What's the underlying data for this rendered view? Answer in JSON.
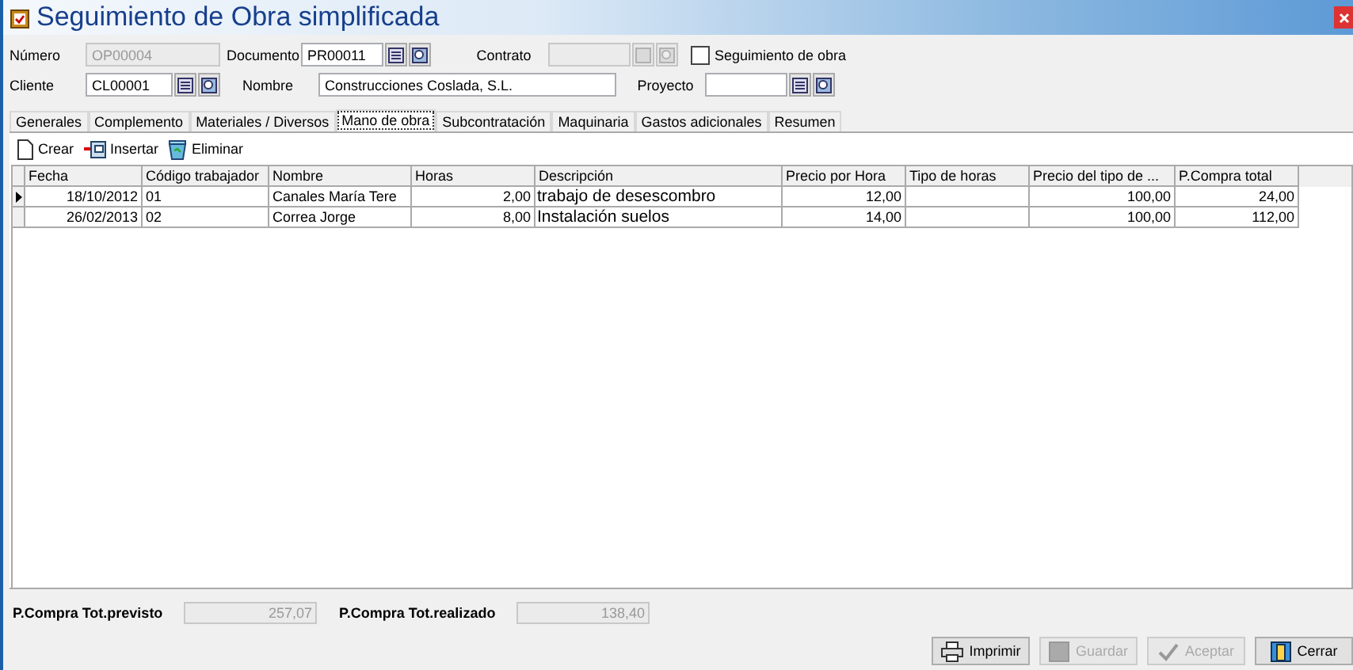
{
  "window": {
    "title": "Seguimiento de Obra simplificada"
  },
  "header": {
    "numero": {
      "label": "Número",
      "value": "OP00004",
      "disabled": true
    },
    "documento": {
      "label": "Documento",
      "value": "PR00011",
      "disabled": false
    },
    "contrato": {
      "label": "Contrato",
      "disabled": true
    },
    "seguimiento": {
      "label": "Seguimiento de obra",
      "checked": false
    },
    "cliente": {
      "label": "Cliente",
      "value": "CL00001",
      "disabled": false
    },
    "nombre": {
      "label": "Nombre",
      "value": "Construcciones Coslada, S.L."
    },
    "proyecto": {
      "label": "Proyecto",
      "disabled": false
    }
  },
  "tabs": [
    {
      "label": "Generales",
      "selected": false
    },
    {
      "label": "Complemento",
      "selected": false
    },
    {
      "label": "Materiales / Diversos",
      "selected": false
    },
    {
      "label": "Mano de obra",
      "selected": true
    },
    {
      "label": "Subcontratación",
      "selected": false
    },
    {
      "label": "Maquinaria",
      "selected": false
    },
    {
      "label": "Gastos adicionales",
      "selected": false
    },
    {
      "label": "Resumen",
      "selected": false
    }
  ],
  "toolbar": [
    {
      "label": "Crear",
      "kind": "new"
    },
    {
      "label": "Insertar",
      "kind": "insert"
    },
    {
      "label": "Eliminar",
      "kind": "delete"
    }
  ],
  "table": {
    "columns": [
      "Fecha",
      "Código trabajador",
      "Nombre",
      "Horas",
      "Descripción",
      "Precio por Hora",
      "Tipo de horas",
      "Precio del tipo de ...",
      "P.Compra total"
    ],
    "rows": [
      {
        "selected": true,
        "cells": [
          "18/10/2012",
          "01",
          "Canales María Tere",
          "2,00",
          "trabajo de desescombro",
          "12,00",
          "",
          "100,00",
          "24,00"
        ]
      },
      {
        "selected": false,
        "cells": [
          "26/02/2013",
          "02",
          "Correa Jorge",
          "8,00",
          "Instalación suelos",
          "14,00",
          "",
          "100,00",
          "112,00"
        ]
      }
    ]
  },
  "totals": [
    {
      "label": "P.Compra Tot.previsto",
      "value": "257,07"
    },
    {
      "label": "P.Compra Tot.realizado",
      "value": "138,40"
    }
  ],
  "buttons": [
    {
      "label": "Imprimir",
      "kind": "print",
      "disabled": false
    },
    {
      "label": "Guardar",
      "kind": "save",
      "disabled": true
    },
    {
      "label": "Aceptar",
      "kind": "accept",
      "disabled": true
    },
    {
      "label": "Cerrar",
      "kind": "close",
      "disabled": false
    }
  ]
}
